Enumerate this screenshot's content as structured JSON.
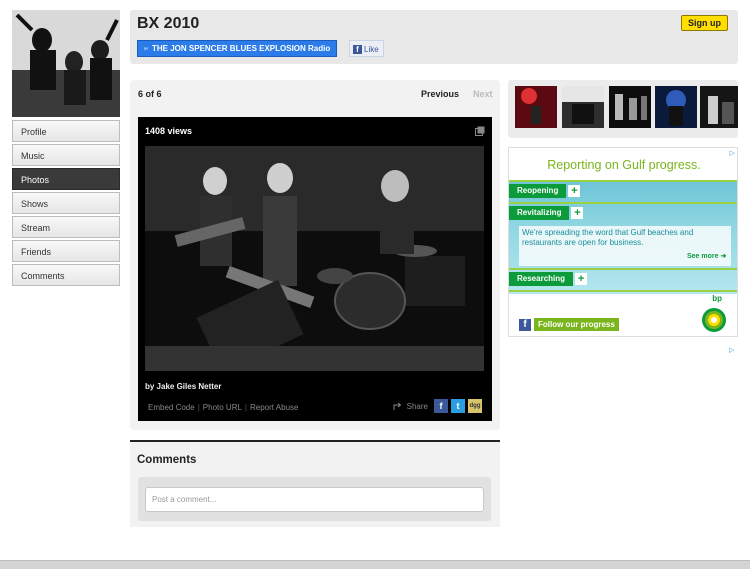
{
  "profile": {
    "title": "BX 2010",
    "signup_label": "Sign up",
    "radio_label": "THE JON SPENCER BLUES EXPLOSION Radio",
    "like_label": "Like"
  },
  "nav": {
    "items": [
      {
        "label": "Profile"
      },
      {
        "label": "Music"
      },
      {
        "label": "Photos"
      },
      {
        "label": "Shows"
      },
      {
        "label": "Stream"
      },
      {
        "label": "Friends"
      },
      {
        "label": "Comments"
      }
    ],
    "active": "Photos"
  },
  "photo_viewer": {
    "counter": "6 of 6",
    "previous_label": "Previous",
    "next_label": "Next",
    "views": "1408 views",
    "credit": "by Jake Giles Netter",
    "links": [
      "Embed Code",
      "Photo URL",
      "Report Abuse"
    ],
    "share_label": "Share",
    "share_icons": [
      "facebook-icon",
      "twitter-icon",
      "digg-icon"
    ]
  },
  "comments": {
    "title": "Comments",
    "placeholder": "Post a comment..."
  },
  "thumbnails": {
    "count": 5
  },
  "ad": {
    "headline": "Reporting on Gulf progress.",
    "rows": [
      "Reopening",
      "Revitalizing",
      "Researching"
    ],
    "description": "We're spreading the word that Gulf beaches and restaurants are open for business.",
    "see_more": "See more",
    "follow": "Follow our progress",
    "brand": "bp",
    "choice_marker": "▷"
  },
  "colors": {
    "accent_yellow": "#ffde00",
    "radio_blue": "#2b7be8",
    "ad_green": "#0c9b3b",
    "ad_lime": "#7ab51d"
  }
}
